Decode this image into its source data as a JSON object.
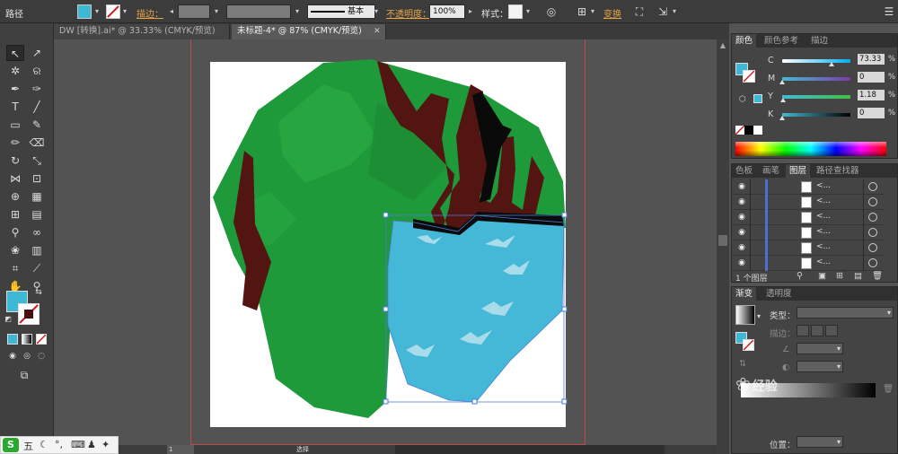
{
  "control_bar": {
    "path_label": "路径",
    "fill_color": "#3fb8d6",
    "stroke_label": "描边：",
    "stroke_style": "基本",
    "opacity_label": "不透明度：",
    "opacity_value": "100%",
    "style_label": "样式：",
    "transform_label": "变换"
  },
  "tabs": [
    {
      "label": "DW [转换].ai* @ 33.33% (CMYK/预览)",
      "active": false
    },
    {
      "label": "未标题-4* @ 87% (CMYK/预览)",
      "active": true
    }
  ],
  "toolbar": {
    "fill_color": "#3fb8d6"
  },
  "status": {
    "zoom": "87%",
    "page": "1",
    "tool": "选择"
  },
  "color_panel": {
    "tabs": [
      "颜色",
      "颜色参考",
      "描边"
    ],
    "channels": [
      {
        "name": "C",
        "value": "73.33",
        "fraction": 0.73,
        "gradient": "linear-gradient(to right,#ffffff,#00aeef)"
      },
      {
        "name": "M",
        "value": "0",
        "fraction": 0.0,
        "gradient": "linear-gradient(to right,#46b9d6,#7a3ca6)"
      },
      {
        "name": "Y",
        "value": "1.18",
        "fraction": 0.012,
        "gradient": "linear-gradient(to right,#46b9d6,#3fbf46)"
      },
      {
        "name": "K",
        "value": "0",
        "fraction": 0.0,
        "gradient": "linear-gradient(to right,#46b9d6,#000000)"
      }
    ],
    "percent_sign": "%"
  },
  "layers_panel": {
    "tabs": [
      "色板",
      "画笔",
      "图层",
      "路径查找器"
    ],
    "rows": [
      {
        "name": "<..."
      },
      {
        "name": "<..."
      },
      {
        "name": "<..."
      },
      {
        "name": "<..."
      },
      {
        "name": "<..."
      },
      {
        "name": "<..."
      }
    ],
    "footer": "1 个图层"
  },
  "gradient_panel": {
    "tabs": [
      "渐变",
      "透明度"
    ],
    "type_label": "类型：",
    "stroke_label": "描边：",
    "position_label": "位置："
  },
  "watermark": "经验",
  "taskbar": {
    "ime": "五"
  }
}
